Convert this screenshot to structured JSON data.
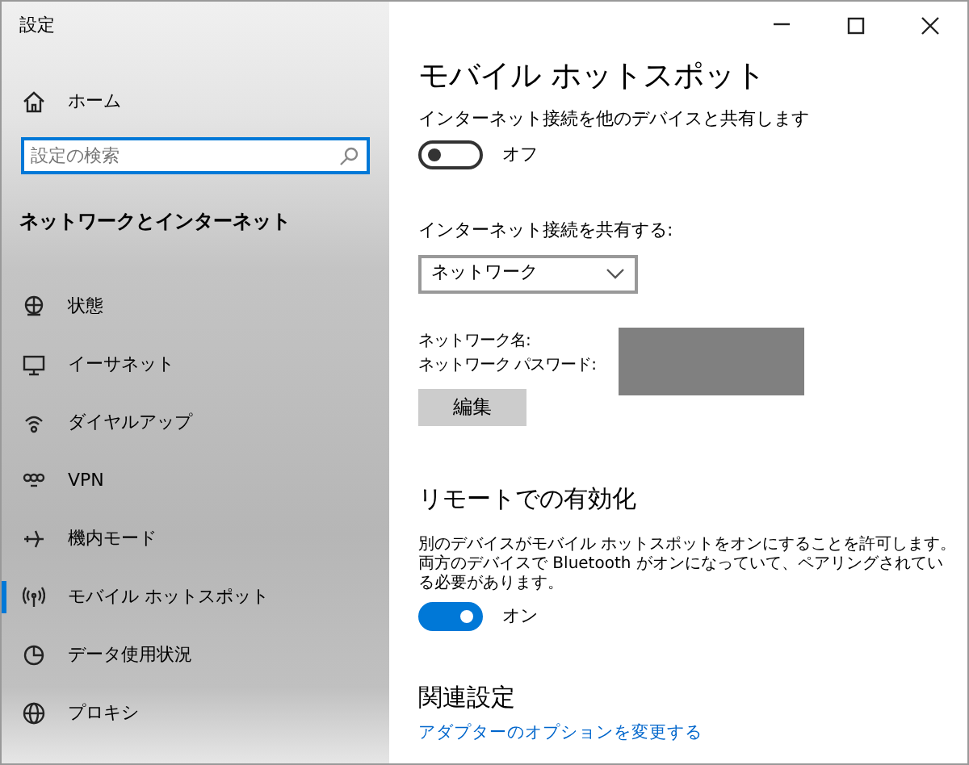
{
  "window": {
    "title": "設定"
  },
  "sidebar": {
    "home": "ホーム",
    "search": {
      "placeholder": "設定の検索"
    },
    "heading": "ネットワークとインターネット",
    "items": [
      {
        "label": "状態",
        "selected": false
      },
      {
        "label": "イーサネット",
        "selected": false
      },
      {
        "label": "ダイヤルアップ",
        "selected": false
      },
      {
        "label": "VPN",
        "selected": false
      },
      {
        "label": "機内モード",
        "selected": false
      },
      {
        "label": "モバイル ホットスポット",
        "selected": true
      },
      {
        "label": "データ使用状況",
        "selected": false
      },
      {
        "label": "プロキシ",
        "selected": false
      }
    ]
  },
  "page": {
    "title": "モバイル ホットスポット",
    "share": {
      "label": "インターネット接続を他のデバイスと共有します",
      "on": false,
      "state": "オフ"
    },
    "share_from": {
      "label": "インターネット接続を共有する:",
      "value": "ネットワーク"
    },
    "network_name_label": "ネットワーク名:",
    "password_label": "ネットワーク パスワード:",
    "edit_button": "編集",
    "remote": {
      "heading": "リモートでの有効化",
      "description": "別のデバイスがモバイル ホットスポットをオンにすることを許可します。両方のデバイスで Bluetooth がオンになっていて、ペアリングされている必要があります。",
      "on": true,
      "state": "オン"
    },
    "related": {
      "heading": "関連設定",
      "link": "アダプターのオプションを変更する"
    }
  }
}
